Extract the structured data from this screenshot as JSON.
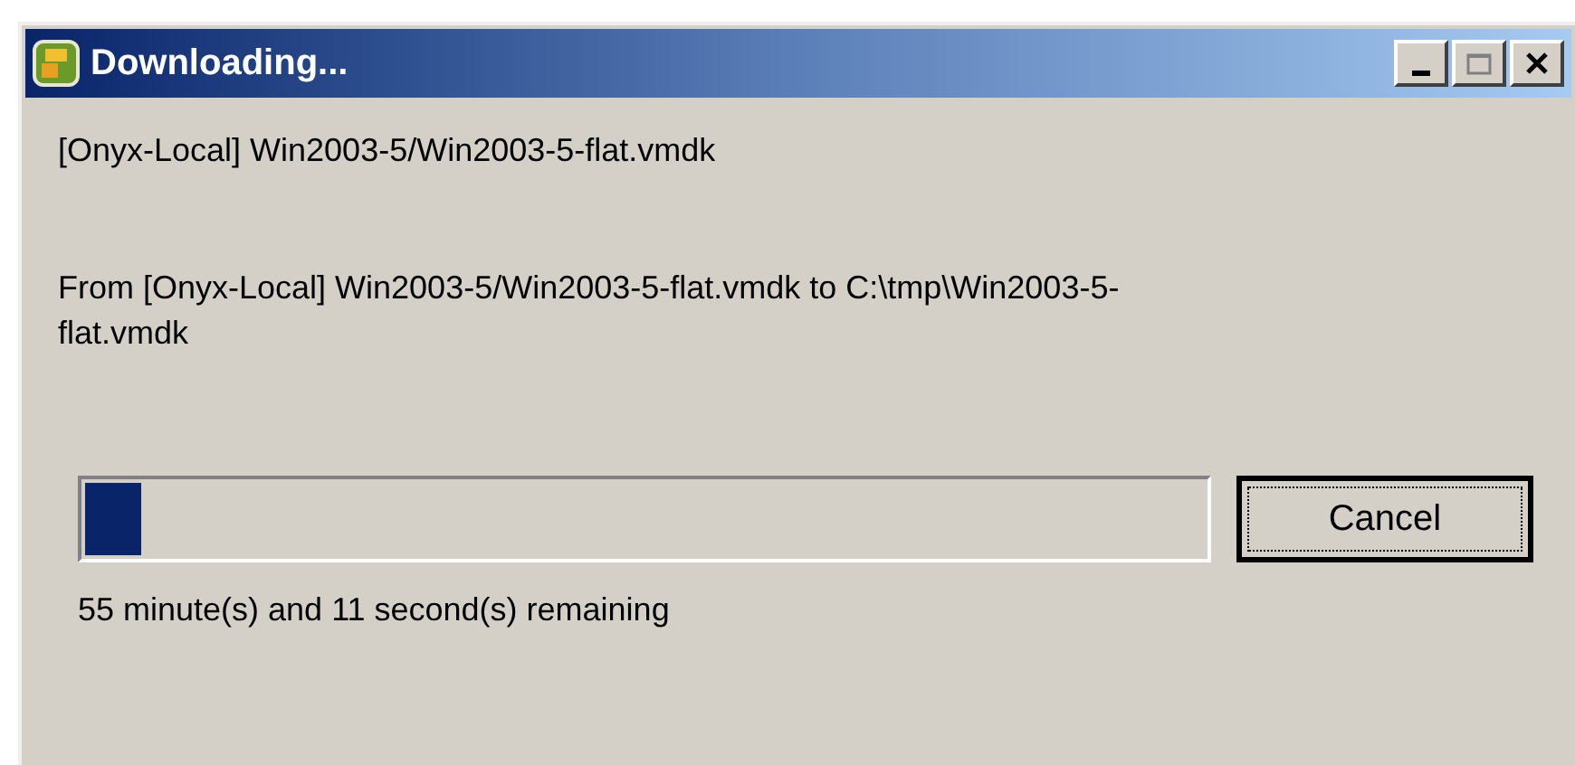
{
  "window": {
    "title": "Downloading..."
  },
  "source": "[Onyx-Local] Win2003-5/Win2003-5-flat.vmdk",
  "transfer": "From [Onyx-Local] Win2003-5/Win2003-5-flat.vmdk to C:\\tmp\\Win2003-5-flat.vmdk",
  "progress": {
    "level": 0.05
  },
  "buttons": [
    {
      "label": "Cancel",
      "focused": true
    }
  ],
  "status": "55 minute(s) and 11 second(s) remaining"
}
